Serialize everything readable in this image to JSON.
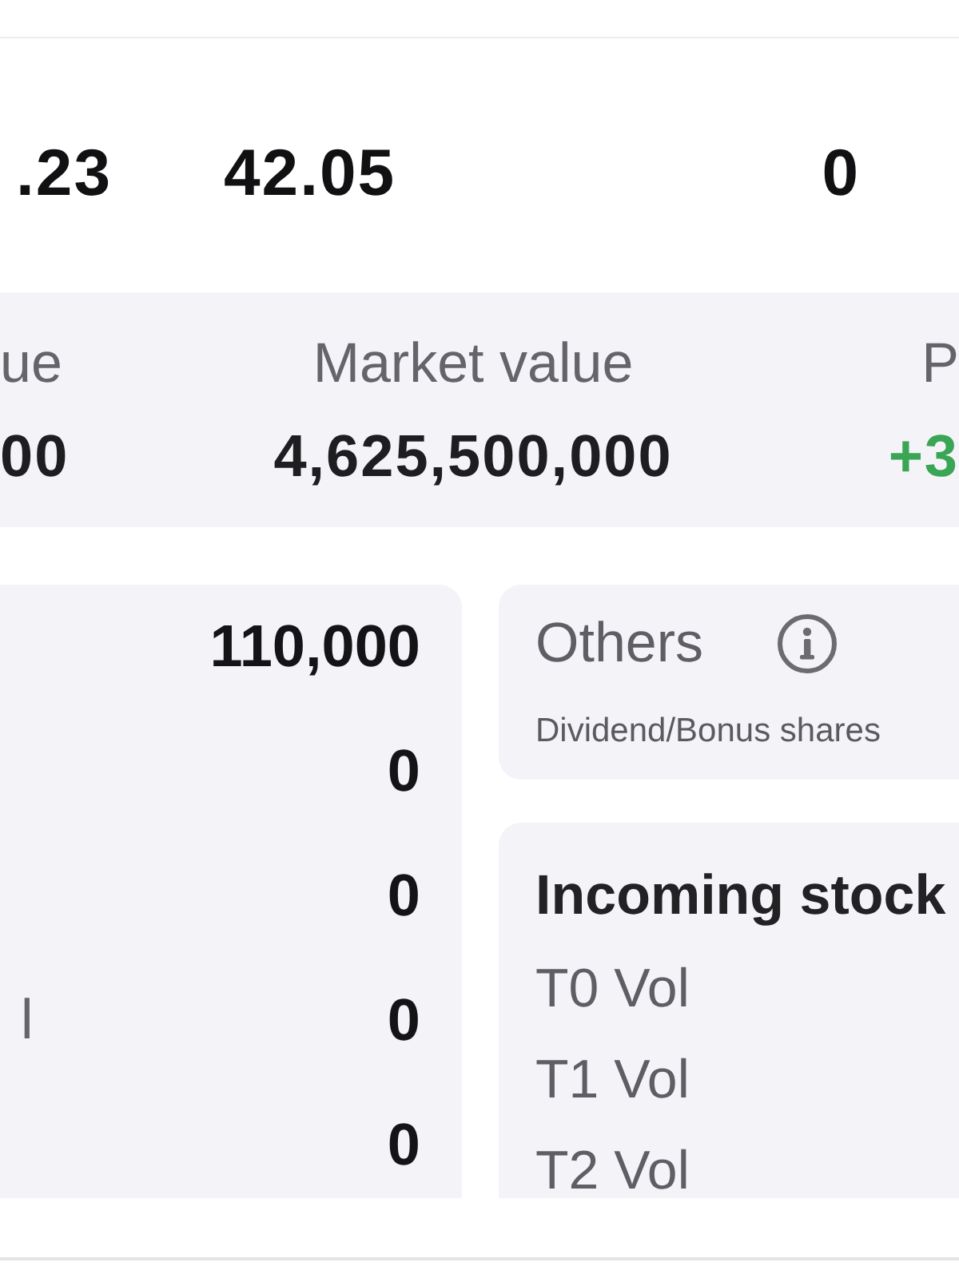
{
  "stats": [
    {
      "value": ".23"
    },
    {
      "value": "42.05"
    },
    {
      "value": "0"
    }
  ],
  "summary": {
    "columns": [
      {
        "label": "ue",
        "value": "00",
        "gain": false
      },
      {
        "label": "Market value",
        "value": "4,625,500,000",
        "gain": false
      },
      {
        "label": "P",
        "value": "+3",
        "gain": true
      }
    ]
  },
  "holdings": {
    "rows": [
      {
        "value": "110,000"
      },
      {
        "value": "0"
      },
      {
        "value": "0"
      },
      {
        "label": "l",
        "value": "0"
      },
      {
        "value": "0"
      }
    ]
  },
  "others": {
    "title": "Others",
    "subtitle": "Dividend/Bonus shares"
  },
  "incoming": {
    "title": "Incoming stock",
    "rows": [
      {
        "label": "T0 Vol"
      },
      {
        "label": "T1 Vol"
      },
      {
        "label": "T2 Vol"
      }
    ]
  }
}
